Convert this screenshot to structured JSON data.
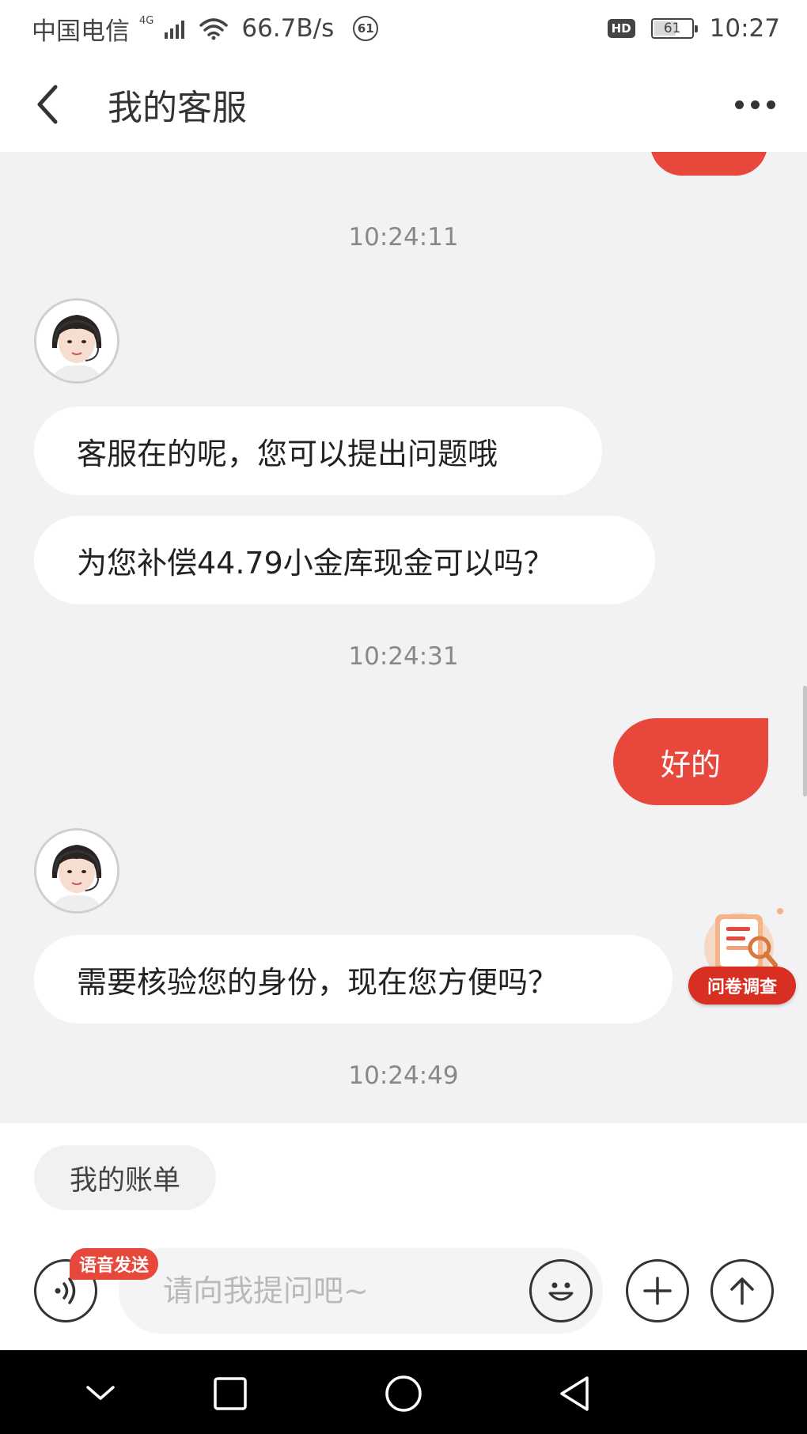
{
  "status_bar": {
    "carrier": "中国电信",
    "network_type": "4G",
    "net_speed": "66.7B/s",
    "notification_count": "61",
    "hd_label": "HD",
    "battery_level": "61",
    "battery_fraction": 0.61,
    "time": "10:27"
  },
  "nav": {
    "title": "我的客服"
  },
  "chat": {
    "timestamps": [
      "10:24:11",
      "10:24:31",
      "10:24:49"
    ],
    "agent_messages": [
      "客服在的呢，您可以提出问题哦",
      "为您补偿44.79小金库现金可以吗？",
      "需要核验您的身份，现在您方便吗？"
    ],
    "user_messages": [
      "好的"
    ]
  },
  "survey": {
    "label": "问卷调查"
  },
  "quick_replies": [
    "我的账单"
  ],
  "composer": {
    "voice_tag": "语音发送",
    "placeholder": "请向我提问吧~"
  },
  "colors": {
    "accent": "#e8473b",
    "background": "#f2f2f4",
    "bubble_agent": "#ffffff"
  },
  "icons": {
    "back": "chevron-left-icon",
    "more": "more-dots-icon",
    "voice": "voice-wave-icon",
    "emoji": "smiley-icon",
    "plus": "plus-icon",
    "send": "arrow-up-icon"
  }
}
